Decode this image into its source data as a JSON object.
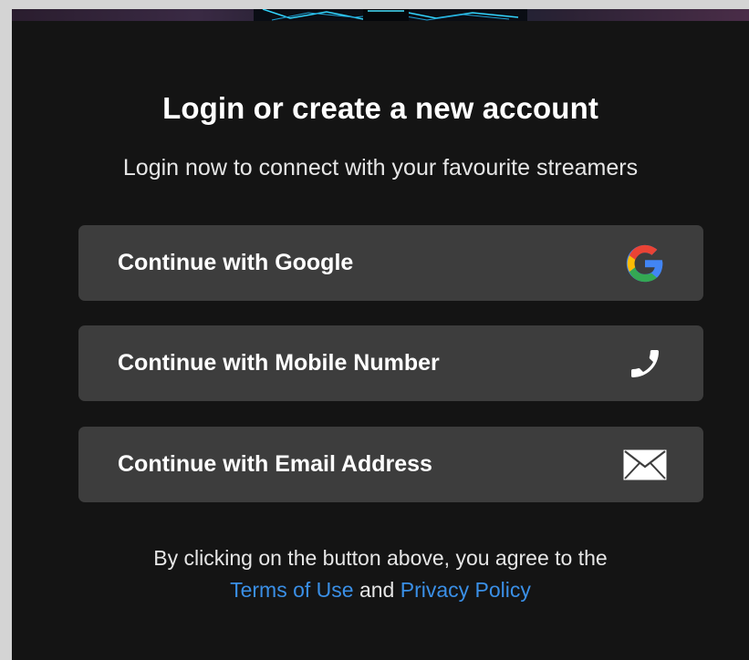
{
  "modal": {
    "title": "Login or create a new account",
    "subtitle": "Login now to connect with your favourite streamers"
  },
  "buttons": {
    "google": {
      "label": "Continue with Google",
      "icon": "google-icon"
    },
    "mobile": {
      "label": "Continue with Mobile Number",
      "icon": "phone-icon"
    },
    "email": {
      "label": "Continue with Email Address",
      "icon": "envelope-icon"
    }
  },
  "footer": {
    "line1": "By clicking on the button above, you agree to the",
    "terms_link": "Terms of Use",
    "and_text": "and",
    "privacy_link": "Privacy Policy"
  },
  "colors": {
    "background": "#141414",
    "button": "#3d3d3d",
    "link": "#3a8fe6"
  }
}
